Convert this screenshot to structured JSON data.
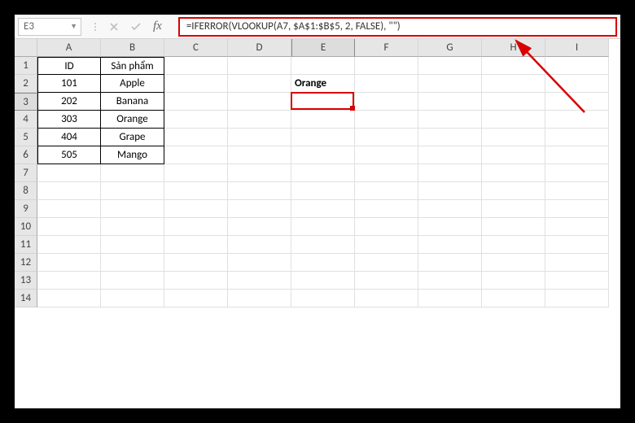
{
  "name_box": "E3",
  "formula": "=IFERROR(VLOOKUP(A7, $A$1:$B$5, 2, FALSE), \"\")",
  "fx_label": "fx",
  "columns": [
    "A",
    "B",
    "C",
    "D",
    "E",
    "F",
    "G",
    "H",
    "I"
  ],
  "rows": [
    "1",
    "2",
    "3",
    "4",
    "5",
    "6",
    "7",
    "8",
    "9",
    "10",
    "11",
    "12",
    "13",
    "14"
  ],
  "tableA": {
    "header": {
      "A": "ID",
      "B": "Sản phẩm"
    },
    "rows": [
      {
        "A": "101",
        "B": "Apple"
      },
      {
        "A": "202",
        "B": "Banana"
      },
      {
        "A": "303",
        "B": "Orange"
      },
      {
        "A": "404",
        "B": "Grape"
      },
      {
        "A": "505",
        "B": "Mango"
      }
    ]
  },
  "cellE2": "Orange",
  "active_col": "E",
  "active_row": "3"
}
